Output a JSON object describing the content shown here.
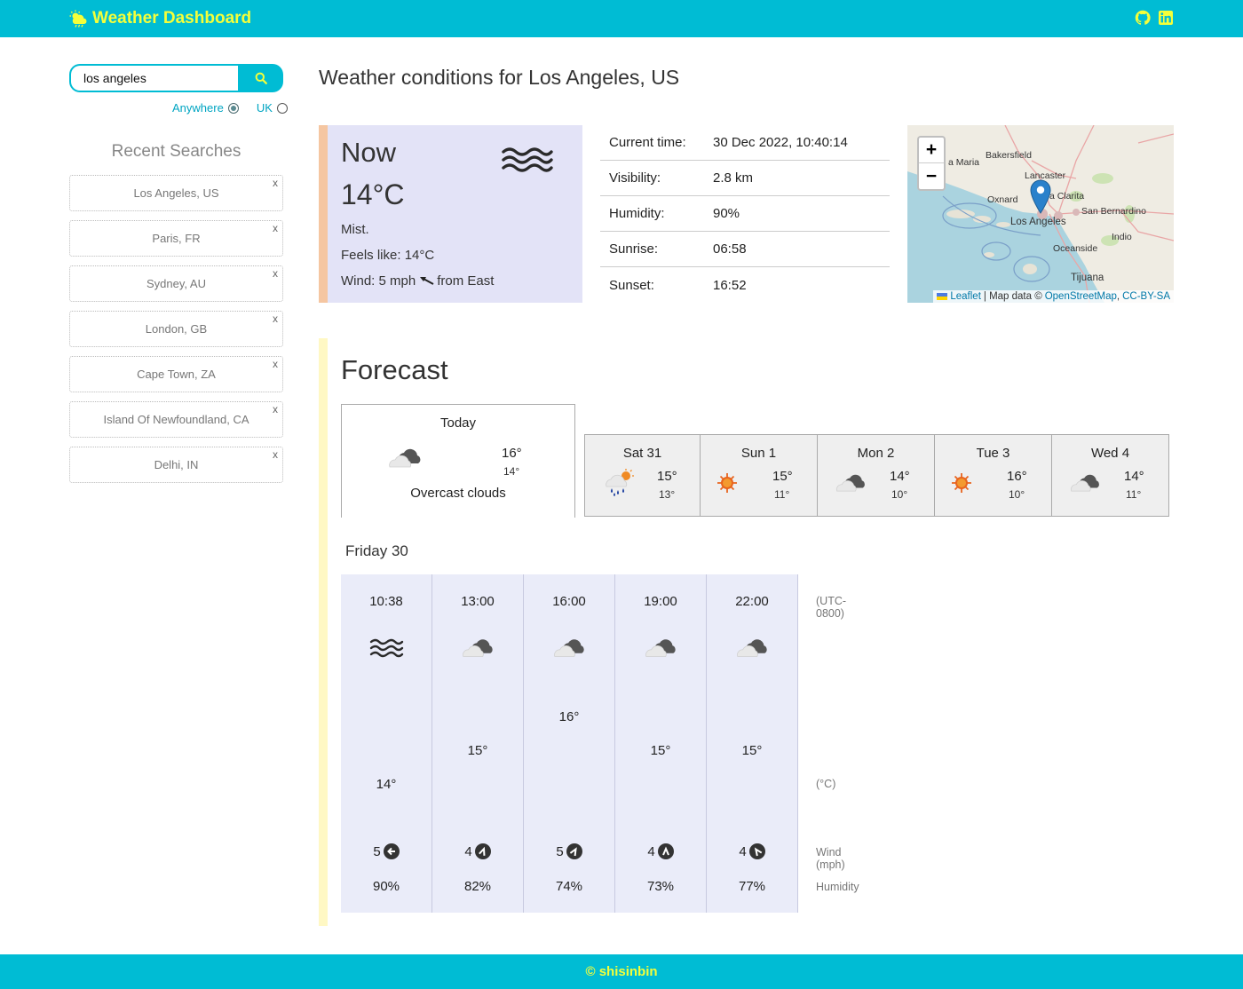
{
  "header": {
    "title": "Weather Dashboard",
    "icons": [
      "github-icon",
      "linkedin-icon"
    ]
  },
  "search": {
    "value": "los angeles",
    "button_icon": "search-icon",
    "options": [
      {
        "label": "Anywhere",
        "checked": true
      },
      {
        "label": "UK",
        "checked": false
      }
    ]
  },
  "recent": {
    "title": "Recent Searches",
    "items": [
      {
        "label": "Los Angeles, US",
        "remove": "x"
      },
      {
        "label": "Paris, FR",
        "remove": "x"
      },
      {
        "label": "Sydney, AU",
        "remove": "x"
      },
      {
        "label": "London, GB",
        "remove": "x"
      },
      {
        "label": "Cape Town, ZA",
        "remove": "x"
      },
      {
        "label": "Island Of Newfoundland, CA",
        "remove": "x"
      },
      {
        "label": "Delhi, IN",
        "remove": "x"
      }
    ]
  },
  "main": {
    "title": "Weather conditions for Los Angeles, US"
  },
  "now": {
    "label": "Now",
    "temp": "14°C",
    "icon": "mist-icon",
    "description": "Mist.",
    "feels": "Feels like: 14°C",
    "wind_speed": "Wind: 5 mph",
    "wind_from": "from East"
  },
  "details": [
    {
      "key": "Current time:",
      "value": "30 Dec 2022, 10:40:14"
    },
    {
      "key": "Visibility:",
      "value": "2.8 km"
    },
    {
      "key": "Humidity:",
      "value": "90%"
    },
    {
      "key": "Sunrise:",
      "value": "06:58"
    },
    {
      "key": "Sunset:",
      "value": "16:52"
    }
  ],
  "map": {
    "zoom_in": "+",
    "zoom_out": "−",
    "places": [
      "Bakersfield",
      "a Maria",
      "Lancaster",
      "a Clarita",
      "Oxnard",
      "Los Angeles",
      "San Bernardino",
      "Indio",
      "Oceanside",
      "Tijuana"
    ],
    "attribution": {
      "leaflet": "Leaflet",
      "text": "| Map data ©",
      "osm": "OpenStreetMap",
      "sep": ",",
      "license": "CC-BY-SA"
    }
  },
  "forecast": {
    "title": "Forecast",
    "today": {
      "day": "Today",
      "icon": "overcast-clouds-icon",
      "hi": "16°",
      "lo": "14°",
      "desc": "Overcast clouds"
    },
    "days": [
      {
        "day": "Sat 31",
        "icon": "rain-sun-icon",
        "hi": "15°",
        "lo": "13°"
      },
      {
        "day": "Sun 1",
        "icon": "sun-icon",
        "hi": "15°",
        "lo": "11°"
      },
      {
        "day": "Mon 2",
        "icon": "cloud-icon",
        "hi": "14°",
        "lo": "10°"
      },
      {
        "day": "Tue 3",
        "icon": "sun-icon",
        "hi": "16°",
        "lo": "10°"
      },
      {
        "day": "Wed 4",
        "icon": "cloud-icon",
        "hi": "14°",
        "lo": "11°"
      }
    ],
    "day_title": "Friday 30",
    "hours": [
      {
        "time": "10:38",
        "icon": "mist-icon",
        "temp": "14°",
        "temp_value": 14,
        "wind": "5",
        "wind_dir": "arrow-left-icon",
        "humidity": "90%"
      },
      {
        "time": "13:00",
        "icon": "cloud-icon",
        "temp": "15°",
        "temp_value": 15,
        "wind": "4",
        "wind_dir": "arrow-up-right-icon",
        "humidity": "82%"
      },
      {
        "time": "16:00",
        "icon": "cloud-icon",
        "temp": "16°",
        "temp_value": 16,
        "wind": "5",
        "wind_dir": "arrow-up-right-icon",
        "humidity": "74%"
      },
      {
        "time": "19:00",
        "icon": "cloud-icon",
        "temp": "15°",
        "temp_value": 15,
        "wind": "4",
        "wind_dir": "arrow-up-icon",
        "humidity": "73%"
      },
      {
        "time": "22:00",
        "icon": "cloud-icon",
        "temp": "15°",
        "temp_value": 15,
        "wind": "4",
        "wind_dir": "arrow-up-left-icon",
        "humidity": "77%"
      }
    ],
    "labels": {
      "tz": "(UTC-0800)",
      "unit": "(°C)",
      "wind": "Wind (mph)",
      "humidity": "Humidity"
    }
  },
  "footer": {
    "text": "© shisinbin"
  },
  "colors": {
    "primary": "#00bcd4",
    "accent": "#f4ff3a",
    "now_bg": "#e3e3f7",
    "now_border": "#f5c6a1",
    "forecast_border": "#fff8c4"
  }
}
